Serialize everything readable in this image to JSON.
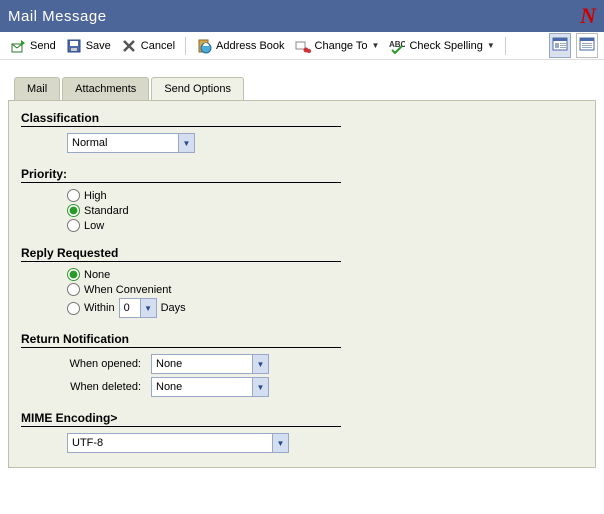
{
  "window": {
    "title": "Mail Message"
  },
  "toolbar": {
    "send": "Send",
    "save": "Save",
    "cancel": "Cancel",
    "address_book": "Address Book",
    "change_to": "Change To",
    "check_spelling": "Check Spelling"
  },
  "tabs": {
    "mail": "Mail",
    "attachments": "Attachments",
    "send_options": "Send Options"
  },
  "classification": {
    "label": "Classification",
    "value": "Normal"
  },
  "priority": {
    "label": "Priority:",
    "options": {
      "high": "High",
      "standard": "Standard",
      "low": "Low"
    },
    "selected": "standard"
  },
  "reply_requested": {
    "label": "Reply Requested",
    "none": "None",
    "when_convenient": "When Convenient",
    "within_prefix": "Within",
    "within_value": "0",
    "within_suffix": "Days",
    "selected": "none"
  },
  "return_notification": {
    "label": "Return Notification",
    "when_opened_label": "When opened:",
    "when_opened_value": "None",
    "when_deleted_label": "When deleted:",
    "when_deleted_value": "None"
  },
  "mime": {
    "label": "MIME Encoding>",
    "value": "UTF-8"
  }
}
